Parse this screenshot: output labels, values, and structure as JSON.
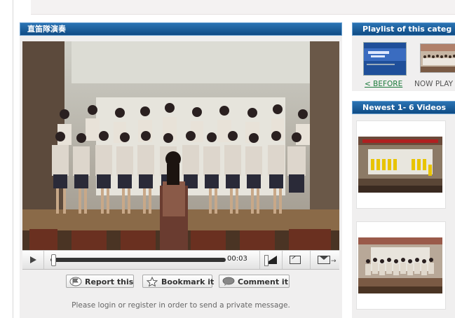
{
  "main": {
    "title": "直笛隊演奏",
    "time": "00:03",
    "progress_fraction": 0.0,
    "buttons": {
      "report": "Report this",
      "bookmark": "Bookmark it",
      "comment": "Comment it"
    },
    "login_message": "Please login or register in order to send a private message."
  },
  "sidebar": {
    "playlist_title": "Playlist of this categ",
    "before_label": "< BEFORE",
    "now_label": "NOW PLAY",
    "newest_title": "Newest 1- 6 Videos"
  },
  "icons": {
    "play": "play-icon",
    "volume": "volume-icon",
    "fullscreen": "fullscreen-icon",
    "share": "email-share-icon",
    "report": "report-flag-icon",
    "bookmark": "star-icon",
    "comment": "speech-bubble-icon"
  },
  "colors": {
    "header_bar": "#1a5a98",
    "panel_bg": "#f0efef",
    "before_link": "#1a7a3a"
  }
}
